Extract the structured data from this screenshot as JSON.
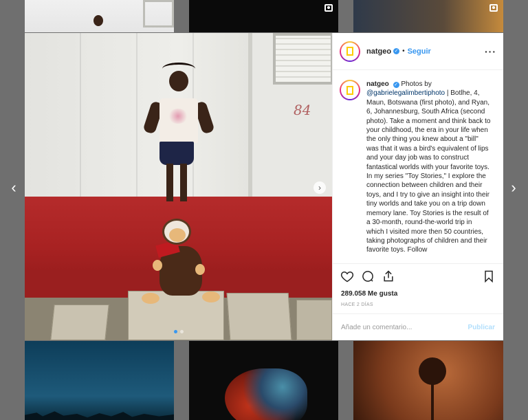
{
  "background": {
    "multi_icon": "multiple-photos-icon"
  },
  "nav": {
    "prev_icon": "‹",
    "next_icon": "›"
  },
  "photo": {
    "door_number": "84",
    "next_icon": "›",
    "slides": 2,
    "active_slide": 1
  },
  "post": {
    "username": "natgeo",
    "verified_mark": "✓",
    "separator": "•",
    "follow_label": "Seguir",
    "more_label": "···",
    "caption_user": "natgeo",
    "caption_prefix": " Photos by ",
    "caption_link": "@gabrielegalimbertiphoto",
    "caption_body": " | Botlhe, 4, Maun, Botswana (first photo), and Ryan, 6, Johannesburg, South Africa (second photo). Take a moment and think back to your childhood, the era in your life when the only thing you knew about a \"bill\" was that it was a bird's equivalent of lips and your day job was to construct fantastical worlds with your favorite toys. In my series \"Toy Stories,\" I explore the connection between children and their toys, and I try to give an insight into their tiny worlds and take you on a trip down memory lane. Toy Stories is the result of a 30-month, round-the-world trip in which I visited more then 50 countries, taking photographs of children and their favorite toys. Follow",
    "likes": "289.058 Me gusta",
    "time_ago": "HACE 2 DÍAS",
    "comment_placeholder": "Añade un comentario...",
    "publish_label": "Publicar"
  },
  "colors": {
    "accent": "#3897f0",
    "floor_red": "#b52b2b",
    "overlay": "#6f6f6f"
  }
}
